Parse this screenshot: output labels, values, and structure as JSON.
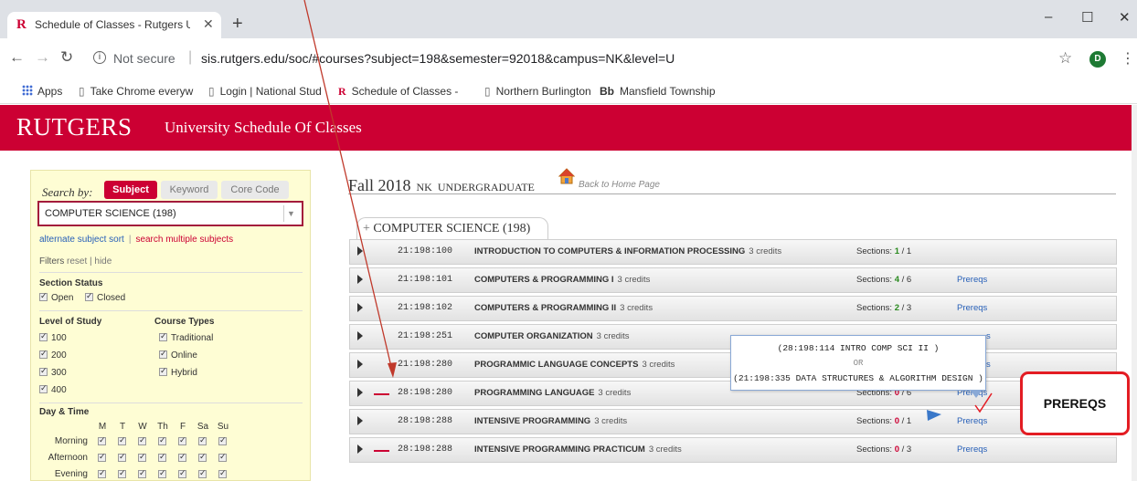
{
  "browser": {
    "tab_title": "Schedule of Classes - Rutgers Un",
    "tab_favicon": "R",
    "url_secure_label": "Not secure",
    "url": "sis.rutgers.edu/soc/#courses?subject=198&semester=92018&campus=NK&level=U",
    "avatar_letter": "D",
    "bookmarks": [
      {
        "label": "Apps",
        "icon": "apps-grid-icon"
      },
      {
        "label": "Take Chrome everyw",
        "icon": "page-icon"
      },
      {
        "label": "Login | National Stud",
        "icon": "page-icon"
      },
      {
        "label": "Schedule of Classes -",
        "icon": "rutgers-r-icon"
      },
      {
        "label": "Northern Burlington",
        "icon": "page-icon"
      },
      {
        "label": "Mansfield Township",
        "icon": "blackboard-icon"
      }
    ]
  },
  "banner": {
    "logo": "RUTGERS",
    "subtitle": "University Schedule Of Classes",
    "color": "#cc0033"
  },
  "search": {
    "label": "Search by:",
    "tabs": [
      "Subject",
      "Keyword",
      "Core Code"
    ],
    "active_tab": "Subject",
    "subject_value": "COMPUTER SCIENCE (198)",
    "link_alt_sort": "alternate subject sort",
    "link_multi": "search multiple subjects",
    "filters_label": "Filters",
    "filters_reset": "reset | hide",
    "section_status_label": "Section Status",
    "status_open": "Open",
    "status_closed": "Closed",
    "level_label": "Level of Study",
    "levels": [
      "100",
      "200",
      "300",
      "400"
    ],
    "course_types_label": "Course Types",
    "course_types": [
      "Traditional",
      "Online",
      "Hybrid"
    ],
    "day_time_label": "Day & Time",
    "days": [
      "M",
      "T",
      "W",
      "Th",
      "F",
      "Sa",
      "Su"
    ],
    "time_slots": [
      "Morning",
      "Afternoon",
      "Evening"
    ]
  },
  "results": {
    "term_season": "Fall 2018",
    "term_campus": "NK",
    "term_level": "UNDERGRADUATE",
    "back_home": "Back to Home Page",
    "subject_header": "COMPUTER SCIENCE (198)",
    "expand_symbol": "+",
    "courses": [
      {
        "code": "21:198:100",
        "title": "INTRODUCTION TO COMPUTERS & INFORMATION PROCESSING",
        "credits": "3 credits",
        "sections_label": "Sections:",
        "open": "1",
        "total": "/ 1",
        "status": "open",
        "prereq": "",
        "dash": false
      },
      {
        "code": "21:198:101",
        "title": "COMPUTERS & PROGRAMMING I",
        "credits": "3 credits",
        "sections_label": "Sections:",
        "open": "4",
        "total": "/ 6",
        "status": "open",
        "prereq": "Prereqs",
        "dash": false
      },
      {
        "code": "21:198:102",
        "title": "COMPUTERS & PROGRAMMING II",
        "credits": "3 credits",
        "sections_label": "Sections:",
        "open": "2",
        "total": "/ 3",
        "status": "open",
        "prereq": "Prereqs",
        "dash": false
      },
      {
        "code": "21:198:251",
        "title": "COMPUTER ORGANIZATION",
        "credits": "3 credits",
        "sections_label": "",
        "open": "",
        "total": "",
        "status": "open",
        "prereq": "s",
        "dash": false
      },
      {
        "code": "21:198:280",
        "title": "PROGRAMMIC LANGUAGE CONCEPTS",
        "credits": "3 credits",
        "sections_label": "",
        "open": "",
        "total": "",
        "status": "open",
        "prereq": "s",
        "dash": false
      },
      {
        "code": "28:198:280",
        "title": "PROGRAMMING LANGUAGE",
        "credits": "3 credits",
        "sections_label": "Sections:",
        "open": "0",
        "total": "/ 6",
        "status": "closed",
        "prereq": "Prereqs",
        "dash": true
      },
      {
        "code": "28:198:288",
        "title": "INTENSIVE PROGRAMMING",
        "credits": "3 credits",
        "sections_label": "Sections:",
        "open": "0",
        "total": "/ 1",
        "status": "closed",
        "prereq": "Prereqs",
        "dash": false
      },
      {
        "code": "28:198:288",
        "title": "INTENSIVE PROGRAMMING PRACTICUM",
        "credits": "3 credits",
        "sections_label": "Sections:",
        "open": "0",
        "total": "/ 3",
        "status": "closed",
        "prereq": "Prereqs",
        "dash": true
      }
    ]
  },
  "tooltip": {
    "line1": "(28:198:114 INTRO COMP SCI II )",
    "or": "OR",
    "line2": "(21:198:335 DATA STRUCTURES & ALGORITHM DESIGN )"
  },
  "annotation": {
    "callout_text": "PREREQS",
    "color": "#e31c23"
  }
}
